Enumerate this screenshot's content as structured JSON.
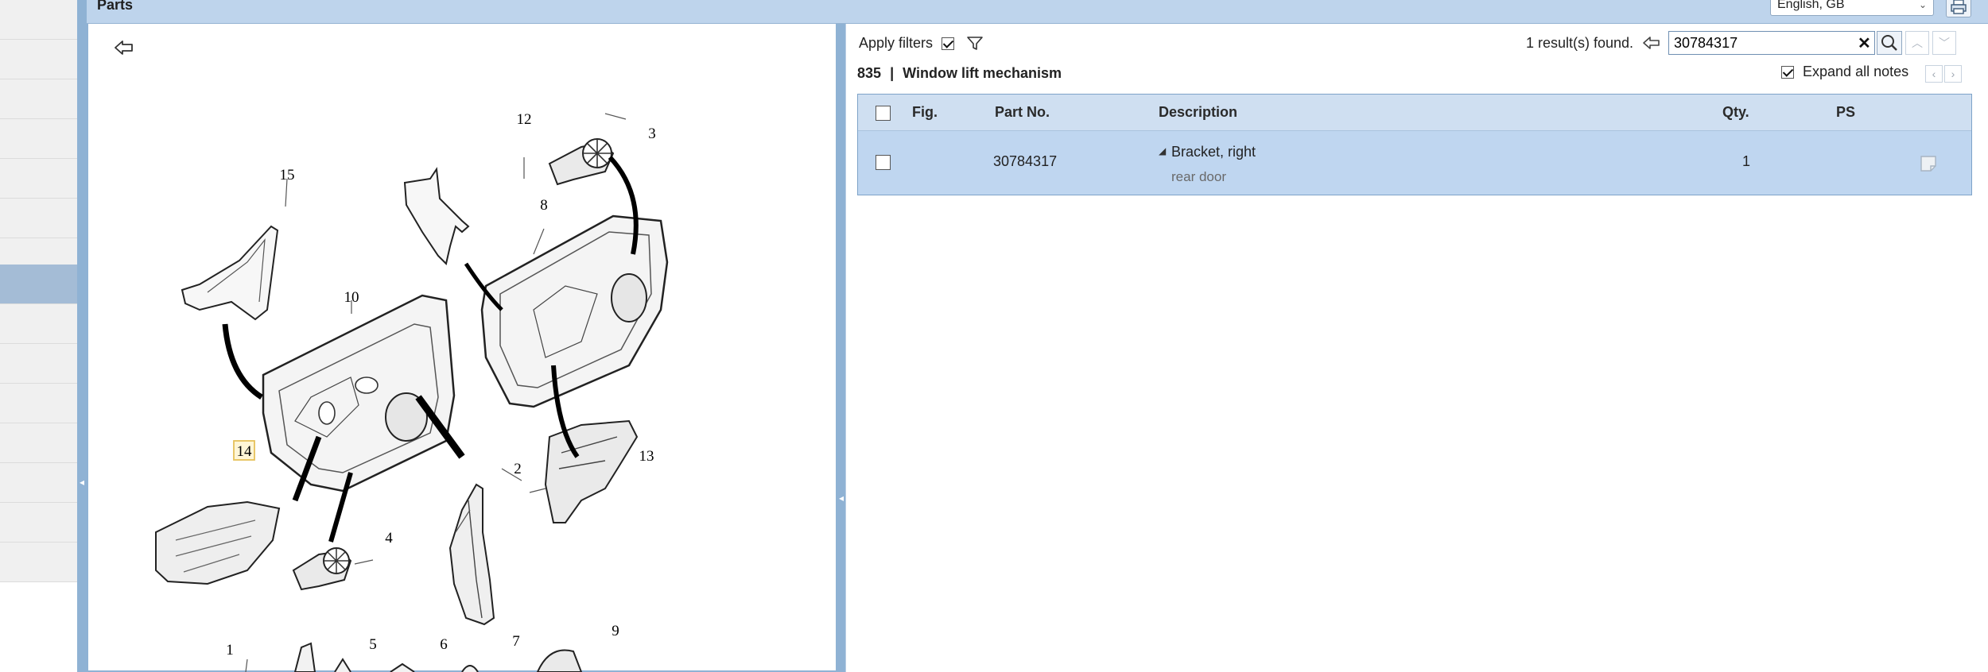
{
  "header": {
    "title": "Parts",
    "language": "English, GB"
  },
  "filters": {
    "apply_label": "Apply filters",
    "apply_checked": true
  },
  "search": {
    "result_text": "1 result(s) found.",
    "query": "30784317"
  },
  "group": {
    "number": "835",
    "separator": "|",
    "name": "Window lift mechanism"
  },
  "notes": {
    "expand_label": "Expand all notes",
    "expand_checked": true
  },
  "table": {
    "columns": {
      "fig": "Fig.",
      "part_no": "Part No.",
      "description": "Description",
      "qty": "Qty.",
      "ps": "PS"
    },
    "rows": [
      {
        "fig": "",
        "part_no": "30784317",
        "description": "Bracket, right",
        "note": "rear door",
        "qty": "1",
        "ps": ""
      }
    ]
  },
  "illustration": {
    "callouts": [
      "15",
      "12",
      "3",
      "8",
      "10",
      "14",
      "2",
      "13",
      "4",
      "1",
      "5",
      "6",
      "7",
      "9"
    ],
    "highlighted_callout": "14"
  },
  "icons": {
    "back": "arrow-left-icon",
    "filter": "funnel-icon",
    "search": "magnifier-icon",
    "clear": "close-icon",
    "print": "printer-icon",
    "note": "note-icon"
  },
  "colors": {
    "header_bg": "#bed4ec",
    "selected_row": "#bfd6f0",
    "active_nav": "#a4bcd6",
    "highlight_box": "#f3d98a"
  }
}
